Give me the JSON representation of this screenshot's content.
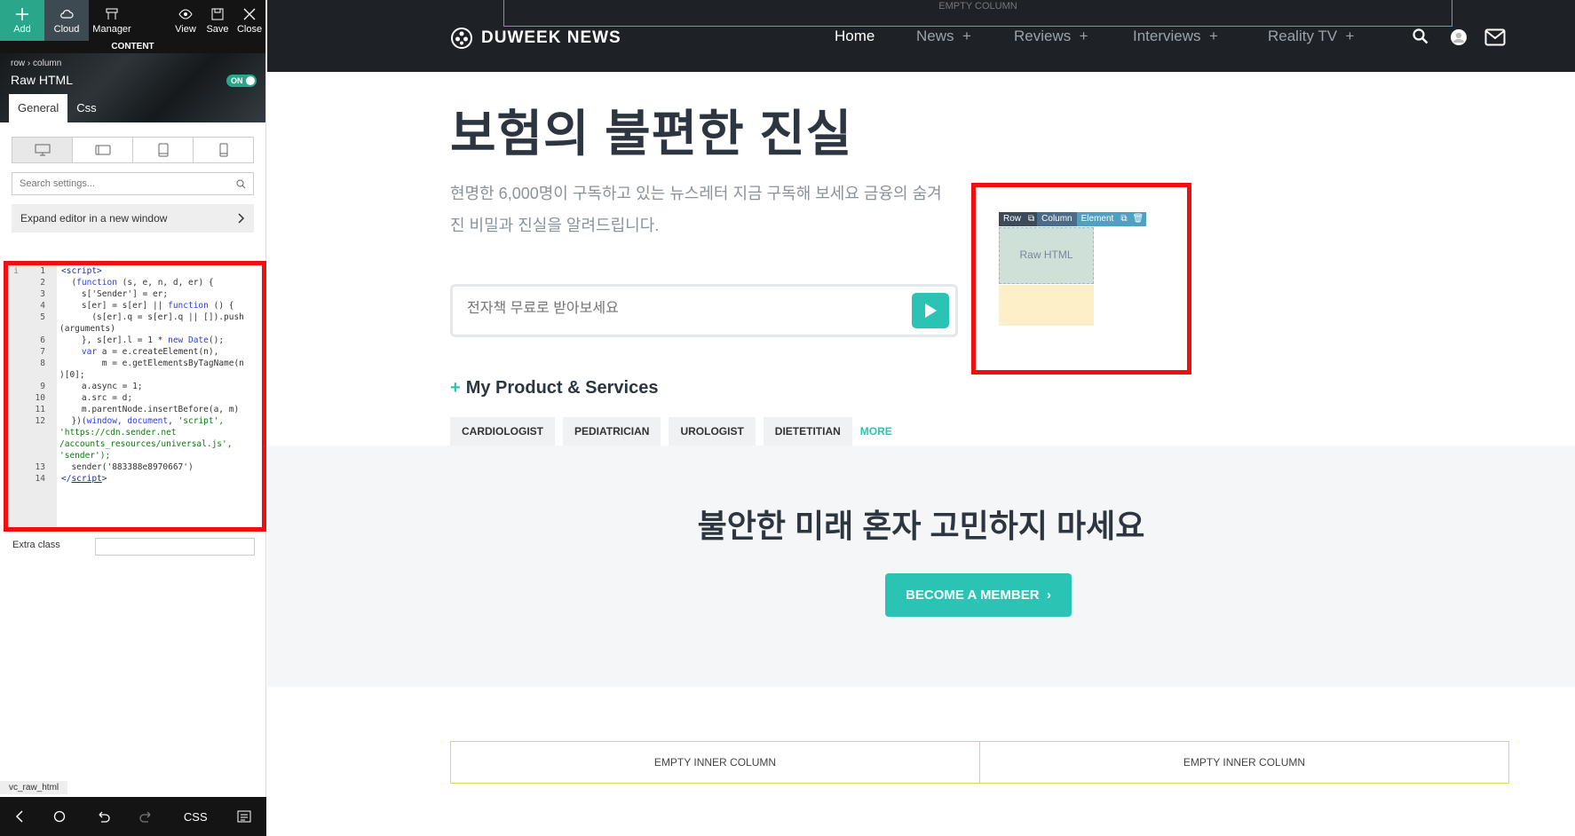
{
  "toolbar": {
    "add": "Add",
    "cloud": "Cloud",
    "manager": "Manager",
    "view": "View",
    "save": "Save",
    "close": "Close",
    "content": "CONTENT"
  },
  "panel": {
    "breadcrumb_row": "row",
    "breadcrumb_sep": "›",
    "breadcrumb_column": "column",
    "element_title": "Raw HTML",
    "toggle": "ON",
    "tabs": [
      "General",
      "Css"
    ],
    "search_placeholder": "Search settings...",
    "expand_label": "Expand editor in a new window",
    "extra_class_label": "Extra class",
    "vc_tag": "vc_raw_html",
    "bottom_css": "CSS"
  },
  "code": {
    "l1": "<script>",
    "l2a": "  (",
    "l2kw": "function",
    "l2b": " (s, e, n, d, er) {",
    "l3": "    s['Sender'] = er;",
    "l4a": "    s[er] = s[er] || ",
    "l4kw": "function",
    "l4b": " () {",
    "l5": "      (s[er].q = s[er].q || []).push",
    "l5w": "(arguments)",
    "l6a": "    }, s[er].l = 1 * ",
    "l6kw": "new Date",
    "l6b": "();",
    "l7a": "    ",
    "l7kw": "var",
    "l7b": " a = e.createElement(n),",
    "l8": "        m = e.getElementsByTagName(n",
    "l8w": ")[0];",
    "l9": "    a.async = 1;",
    "l10": "    a.src = d;",
    "l11": "    m.parentNode.insertBefore(a, m)",
    "l12a": "  })(",
    "l12kw": "window, document",
    "l12b": ", ",
    "l12st": "'script',",
    "l12w1": "'https://cdn.sender.net",
    "l12w2": "/accounts_resources/universal.js',",
    "l12w3": "'sender');",
    "l13": "  sender('883388e8970667')",
    "l14a": "</",
    "l14b": "script",
    "l14c": ">",
    "nums": [
      "1",
      "2",
      "3",
      "4",
      "5",
      "6",
      "7",
      "8",
      "9",
      "10",
      "11",
      "12",
      "13",
      "14"
    ]
  },
  "site": {
    "empty_top": "EMPTY COLUMN",
    "logo": "DUWEEK NEWS",
    "nav": [
      "Home",
      "News  +",
      "Reviews  +",
      "Interviews  +",
      "Reality TV  +"
    ],
    "hero_title": "보험의 불편한 진실",
    "hero_sub": "현명한 6,000명이 구독하고 있는 뉴스레터 지금 구독해 보세요 금융의 숨겨진 비밀과 진실을 알려드립니다.",
    "ebook_placeholder": "전자책 무료로 받아보세요",
    "controls": [
      "Row",
      "Column",
      "Element"
    ],
    "raw_label": "Raw HTML",
    "ps_plus": "+",
    "ps_title": "My Product & Services",
    "pills": [
      "CARDIOLOGIST",
      "PEDIATRICIAN",
      "UROLOGIST",
      "DIETETITIAN"
    ],
    "more": "MORE",
    "gray_title": "불안한 미래 혼자 고민하지 마세요",
    "member_btn": "BECOME A MEMBER  ›",
    "inner_left": "EMPTY INNER COLUMN",
    "inner_right": "EMPTY INNER COLUMN"
  },
  "colors": {
    "accent": "#2bc4b4",
    "editor_green": "#2aa68b",
    "highlight": "#ef0f0f",
    "nav_bg": "#1e2125"
  }
}
